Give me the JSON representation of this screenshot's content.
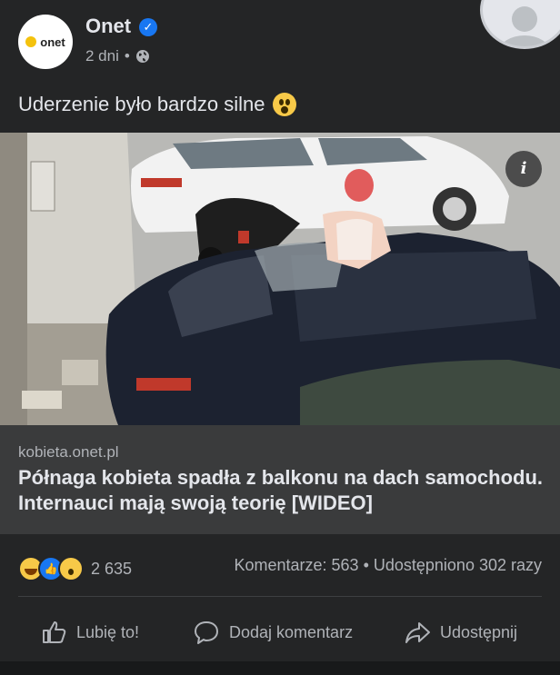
{
  "post": {
    "page_name": "Onet",
    "avatar_text": "onet",
    "time": "2 dni",
    "separator": "•",
    "caption": "Uderzenie było bardzo silne"
  },
  "media": {
    "info_label": "i"
  },
  "link": {
    "domain": "kobieta.onet.pl",
    "title": "Półnaga kobieta spadła z balkonu na dach samochodu. Internauci mają swoją teorię [WIDEO]"
  },
  "stats": {
    "reaction_count": "2 635",
    "comments_shares": "Komentarze: 563 • Udostępniono 302 razy"
  },
  "actions": {
    "like": "Lubię to!",
    "comment": "Dodaj komentarz",
    "share": "Udostępnij"
  },
  "icons": [
    "verified-icon",
    "globe-icon",
    "wow-emoji-icon",
    "info-icon",
    "haha-reaction-icon",
    "like-reaction-icon",
    "wow-reaction-icon",
    "thumb-up-icon",
    "comment-icon",
    "share-icon"
  ],
  "colors": {
    "background": "#242526",
    "preview": "#3a3b3c",
    "accent": "#1877f2"
  }
}
